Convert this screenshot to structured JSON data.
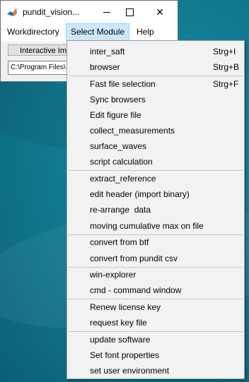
{
  "window": {
    "title": "pundit_vision...",
    "menu": {
      "workdirectory": "Workdirectory",
      "select_module": "Select Module",
      "help": "Help"
    },
    "interactive_button": "Interactive Im",
    "path_value": "C:\\Program Files\\"
  },
  "dropdown": {
    "items": [
      {
        "label": "inter_saft",
        "shortcut": "Strg+I"
      },
      {
        "label": "browser",
        "shortcut": "Strg+B"
      },
      {
        "label": "Fast file selection",
        "shortcut": "Strg+F"
      },
      {
        "label": "Sync browsers",
        "shortcut": ""
      },
      {
        "label": "Edit figure file",
        "shortcut": ""
      },
      {
        "label": "collect_measurements",
        "shortcut": ""
      },
      {
        "label": "surface_waves",
        "shortcut": ""
      },
      {
        "label": "script calculation",
        "shortcut": ""
      },
      {
        "label": "extract_reference",
        "shortcut": ""
      },
      {
        "label": "edit header (import binary)",
        "shortcut": ""
      },
      {
        "label": "re-arrange  data",
        "shortcut": ""
      },
      {
        "label": "moving cumulative max on file",
        "shortcut": ""
      },
      {
        "label": "convert from btf",
        "shortcut": ""
      },
      {
        "label": "convert from pundit csv",
        "shortcut": ""
      },
      {
        "label": "win-explorer",
        "shortcut": ""
      },
      {
        "label": "cmd - command window",
        "shortcut": ""
      },
      {
        "label": "Renew license key",
        "shortcut": ""
      },
      {
        "label": "request key file",
        "shortcut": ""
      },
      {
        "label": "update software",
        "shortcut": ""
      },
      {
        "label": "Set font properties",
        "shortcut": ""
      },
      {
        "label": "set user environment",
        "shortcut": ""
      }
    ]
  },
  "colors": {
    "desktop": "#137f95",
    "menu_highlight": "#cce8ff"
  }
}
